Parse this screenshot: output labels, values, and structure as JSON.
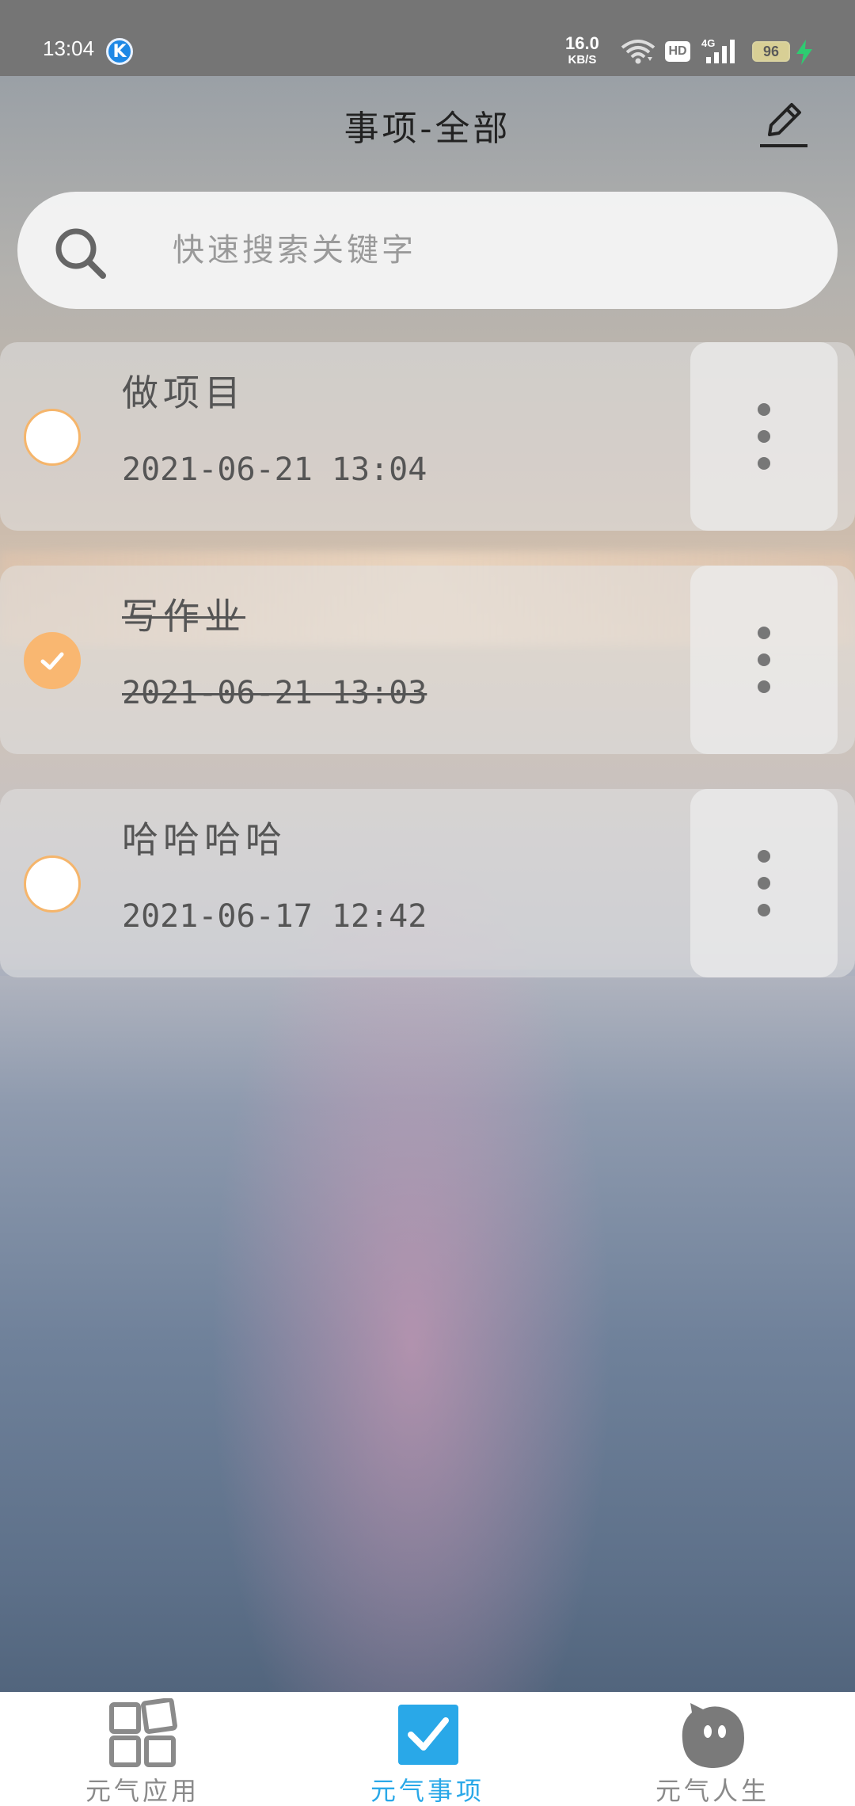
{
  "status_bar": {
    "time": "13:04",
    "app_badge": "K",
    "net_speed_value": "16.0",
    "net_speed_unit": "KB/S",
    "hd_label": "HD",
    "network_label": "4G",
    "battery_level": "96",
    "icons": [
      "wifi-icon",
      "hd-icon",
      "signal-icon",
      "battery-icon",
      "charging-icon"
    ]
  },
  "header": {
    "title": "事项-全部",
    "edit_icon": "pen-icon"
  },
  "search": {
    "placeholder": "快速搜索关键字",
    "icon": "search-icon"
  },
  "tasks": [
    {
      "title": "做项目",
      "date": "2021-06-21 13:04",
      "done": false
    },
    {
      "title": "写作业",
      "date": "2021-06-21 13:03",
      "done": true
    },
    {
      "title": "哈哈哈哈",
      "date": "2021-06-17 12:42",
      "done": false
    }
  ],
  "bottom_nav": {
    "items": [
      {
        "label": "元气应用",
        "icon": "grid-icon",
        "active": false
      },
      {
        "label": "元气事项",
        "icon": "checkbox-icon",
        "active": true
      },
      {
        "label": "元气人生",
        "icon": "mascot-icon",
        "active": false
      }
    ]
  },
  "colors": {
    "accent": "#29a8e8",
    "check_done": "#f9b771",
    "check_border": "#f5b56b",
    "status_bar": "#757575"
  }
}
